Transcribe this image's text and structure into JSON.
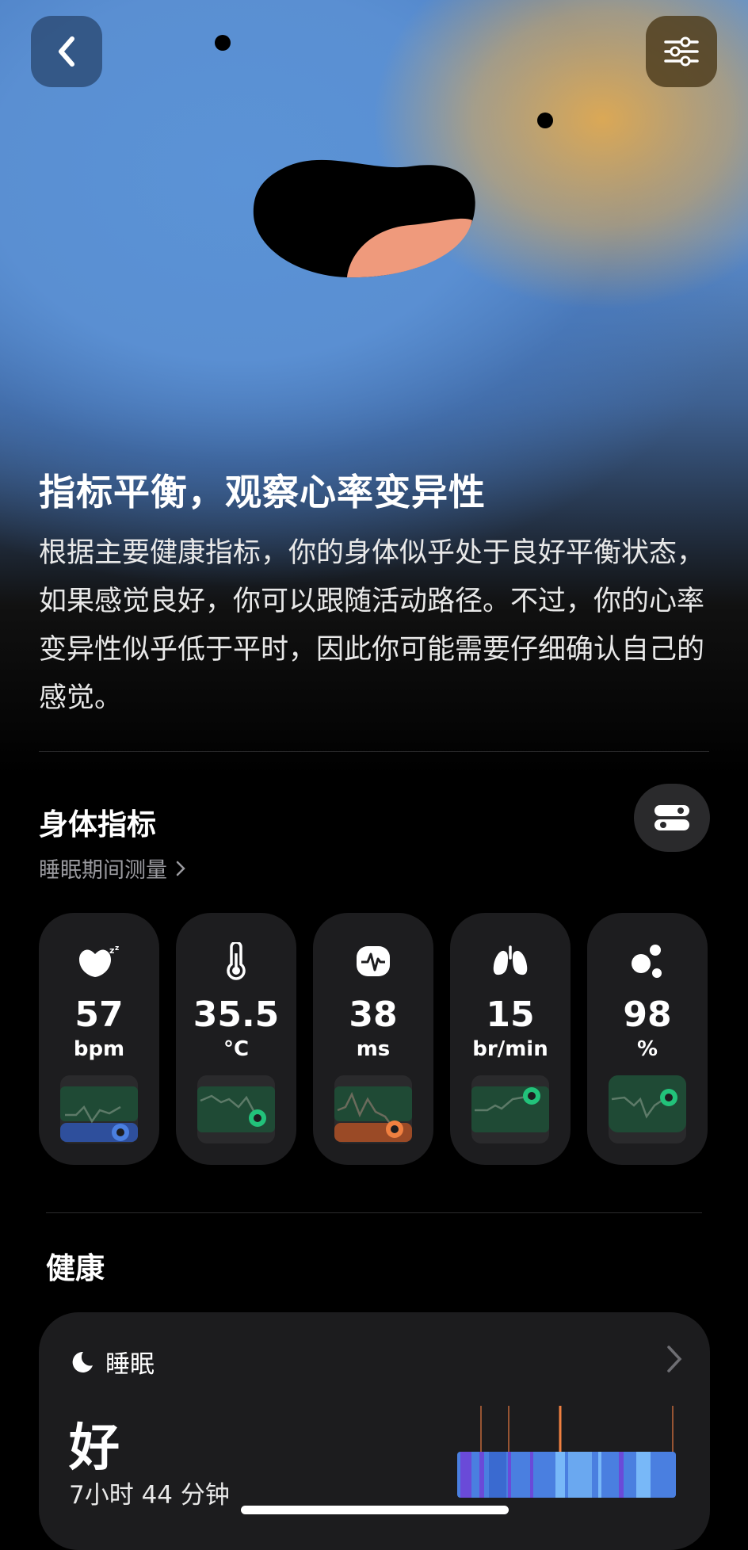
{
  "header": {
    "back_icon": "chevron-left-icon",
    "filter_icon": "sliders-icon"
  },
  "summary": {
    "title": "指标平衡，观察心率变异性",
    "description": "根据主要健康指标，你的身体似乎处于良好平衡状态，如果感觉良好，你可以跟随活动路径。不过，你的心率变异性似乎低于平时，因此你可能需要仔细确认自己的感觉。"
  },
  "metrics": {
    "title": "身体指标",
    "subtitle": "睡眠期间测量",
    "toggle_icon": "toggle-list-icon",
    "cards": [
      {
        "icon": "sleep-heart-icon",
        "value": "57",
        "unit": "bpm",
        "accent": "#4a7fe0"
      },
      {
        "icon": "thermometer-icon",
        "value": "35.5",
        "unit": "°C",
        "accent": "#22c27a"
      },
      {
        "icon": "hrv-icon",
        "value": "38",
        "unit": "ms",
        "accent": "#f08040"
      },
      {
        "icon": "lungs-icon",
        "value": "15",
        "unit": "br/min",
        "accent": "#22c27a"
      },
      {
        "icon": "oxygen-icon",
        "value": "98",
        "unit": "%",
        "accent": "#22c27a"
      }
    ]
  },
  "health": {
    "title": "健康",
    "sleep": {
      "label": "睡眠",
      "icon": "moon-icon",
      "quality": "好",
      "duration": "7小时 44 分钟"
    }
  },
  "colors": {
    "accent_blue": "#4a7fe0",
    "accent_green": "#22c27a",
    "accent_orange": "#f08040",
    "card_bg": "#1d1d1f"
  }
}
